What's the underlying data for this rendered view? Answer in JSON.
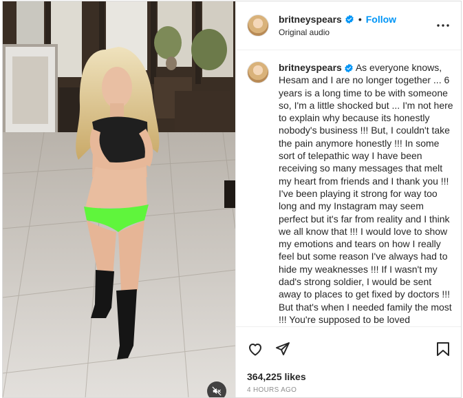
{
  "post": {
    "username": "britneyspears",
    "verified": true,
    "separator": "•",
    "follow_label": "Follow",
    "audio_label": "Original audio",
    "caption": "As everyone knows, Hesam and I are no longer together ... 6 years is a long time to be with someone so, I'm a little shocked but ... I'm not here to explain why because its honestly nobody's business !!! But, I couldn't take the pain anymore honestly !!! In some sort of telepathic way I have been receiving so many messages that melt my heart from friends and I thank you !!! I've been playing it strong for way too long and my Instagram may seem perfect but it's far from reality and I think we all know that !!! I would love to show my emotions and tears on how I really feel but some reason I've always had to hide my weaknesses !!! If I wasn't my dad's strong soldier, I would be sent away to places to get fixed by doctors !!! But that's when I needed family the most !!! You're supposed to be loved unconditionally ... not under",
    "likes_text": "364,225 likes",
    "time_text": "4 HOURS AGO"
  },
  "icons": {
    "more": "more-options-icon",
    "like": "heart-icon",
    "share": "send-icon",
    "save": "bookmark-icon",
    "mute": "muted-speaker-icon",
    "verified": "verified-badge-icon"
  },
  "colors": {
    "accent": "#0095f6",
    "verified": "#0095f6",
    "text": "#262626",
    "muted": "#8e8e8e"
  }
}
